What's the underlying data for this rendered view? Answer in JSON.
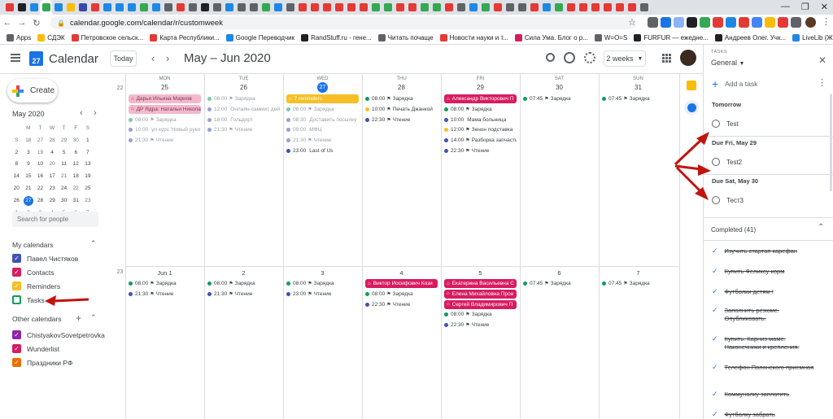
{
  "browser": {
    "url": "calendar.google.com/calendar/r/customweek",
    "bookmarks": [
      "Apps",
      "СДЭК",
      "Петровское сельск...",
      "Карта Республики...",
      "Google Переводчик",
      "RandStuff.ru - гене...",
      "Читать почаще",
      "Новости науки и т...",
      "Сила Ума. Блог о р...",
      "W=O=S",
      "FURFUR — ежедне...",
      "Андреев Олег. Учк...",
      "LiveLib (Живая биб..."
    ],
    "accent": "#1a73e8"
  },
  "header": {
    "app_title": "Calendar",
    "logo_day": "27",
    "today_label": "Today",
    "date_range": "May – Jun 2020",
    "view": "2 weeks"
  },
  "sidebar": {
    "create_label": "Create",
    "mini_month": "May 2020",
    "weekday_heads": [
      "M",
      "T",
      "W",
      "T",
      "F",
      "S",
      "S"
    ],
    "mini_weeks": [
      {
        "wk": "18",
        "days": [
          "27",
          "28",
          "29",
          "30",
          "1",
          "2",
          "3"
        ]
      },
      {
        "wk": "19",
        "days": [
          "4",
          "5",
          "6",
          "7",
          "8",
          "9",
          "10"
        ]
      },
      {
        "wk": "20",
        "days": [
          "11",
          "12",
          "13",
          "14",
          "15",
          "16",
          "17"
        ]
      },
      {
        "wk": "21",
        "days": [
          "18",
          "19",
          "20",
          "21",
          "22",
          "23",
          "24"
        ]
      },
      {
        "wk": "22",
        "days": [
          "25",
          "26",
          "27",
          "28",
          "29",
          "30",
          "31"
        ]
      },
      {
        "wk": "23",
        "days": [
          "1",
          "2",
          "3",
          "4",
          "5",
          "6",
          "7"
        ]
      }
    ],
    "search_placeholder": "Search for people",
    "my_calendars_label": "My calendars",
    "my_calendars": [
      {
        "name": "Павел Чистяков",
        "color": "#3f51b5"
      },
      {
        "name": "Contacts",
        "color": "#d81b60"
      },
      {
        "name": "Reminders",
        "color": "#f6bf26"
      },
      {
        "name": "Tasks",
        "color": "#0f9d58"
      }
    ],
    "other_calendars_label": "Other calendars",
    "other_calendars": [
      {
        "name": "ChistyakovSovetpetrovka",
        "color": "#8e24aa"
      },
      {
        "name": "Wunderlist",
        "color": "#d81b60"
      },
      {
        "name": "Праздники РФ",
        "color": "#ef6c00"
      }
    ]
  },
  "week1": {
    "number": "22",
    "days": [
      {
        "name": "MON",
        "num": "25"
      },
      {
        "name": "TUE",
        "num": "26"
      },
      {
        "name": "WED",
        "num": "27"
      },
      {
        "name": "THU",
        "num": "28"
      },
      {
        "name": "FRI",
        "num": "29"
      },
      {
        "name": "SAT",
        "num": "30"
      },
      {
        "name": "SUN",
        "num": "31"
      }
    ]
  },
  "week2": {
    "number": "23",
    "days": [
      "Jun 1",
      "2",
      "3",
      "4",
      "5",
      "6",
      "7"
    ]
  },
  "events_w1": [
    [
      {
        "kind": "allday",
        "style": "pastpink",
        "text": "Дарья Ильина Мариов"
      },
      {
        "kind": "allday",
        "style": "pastpink",
        "text": "ДР Ядра: Натальи Никола"
      },
      {
        "kind": "timed",
        "past": true,
        "color": "#0f9d58",
        "time": "08:00",
        "flag": true,
        "text": "Зарядка"
      },
      {
        "kind": "timed",
        "past": true,
        "color": "#3f51b5",
        "time": "10:00",
        "flag": false,
        "text": "ул курс 'Новый руко"
      },
      {
        "kind": "timed",
        "past": true,
        "color": "#3f51b5",
        "time": "21:30",
        "flag": true,
        "text": "Чтение"
      }
    ],
    [
      {
        "kind": "timed",
        "past": true,
        "color": "#0f9d58",
        "time": "08:00",
        "flag": true,
        "text": "Зарядка"
      },
      {
        "kind": "timed",
        "past": true,
        "color": "#3f51b5",
        "time": "12:00",
        "flag": false,
        "text": "Онлайн-саммит дей"
      },
      {
        "kind": "timed",
        "past": true,
        "color": "#3f51b5",
        "time": "18:00",
        "flag": false,
        "text": "Гольдорт"
      },
      {
        "kind": "timed",
        "past": true,
        "color": "#3f51b5",
        "time": "21:30",
        "flag": true,
        "text": "Чтение"
      }
    ],
    [
      {
        "kind": "allday",
        "style": "yellow",
        "text": "7 reminders"
      },
      {
        "kind": "timed",
        "past": true,
        "color": "#0f9d58",
        "time": "08:00",
        "flag": true,
        "text": "Зарядка"
      },
      {
        "kind": "timed",
        "past": true,
        "color": "#3f51b5",
        "time": "08:30",
        "flag": false,
        "text": "Доставить посылку"
      },
      {
        "kind": "timed",
        "past": true,
        "color": "#3f51b5",
        "time": "09:00",
        "flag": false,
        "text": "МФЦ"
      },
      {
        "kind": "timed",
        "past": true,
        "color": "#3f51b5",
        "time": "21:30",
        "flag": true,
        "text": "Чтение"
      },
      {
        "kind": "timed",
        "past": false,
        "color": "#3f51b5",
        "time": "23:00",
        "flag": false,
        "text": "Last of Us"
      }
    ],
    [
      {
        "kind": "timed",
        "past": false,
        "color": "#0f9d58",
        "time": "08:00",
        "flag": true,
        "text": "Зарядка"
      },
      {
        "kind": "timed",
        "past": false,
        "color": "#f6bf26",
        "time": "10:00",
        "flag": true,
        "text": "Печать Джанкой"
      },
      {
        "kind": "timed",
        "past": false,
        "color": "#3f51b5",
        "time": "22:30",
        "flag": true,
        "text": "Чтение"
      }
    ],
    [
      {
        "kind": "allday",
        "style": "pink",
        "text": "Александр Викторович П"
      },
      {
        "kind": "timed",
        "past": false,
        "color": "#0f9d58",
        "time": "08:00",
        "flag": true,
        "text": "Зарядка"
      },
      {
        "kind": "timed",
        "past": false,
        "color": "#3f51b5",
        "time": "10:00",
        "flag": false,
        "text": "Мама больница"
      },
      {
        "kind": "timed",
        "past": false,
        "color": "#f6bf26",
        "time": "12:00",
        "flag": true,
        "text": "Зенон подставка"
      },
      {
        "kind": "timed",
        "past": false,
        "color": "#3f51b5",
        "time": "14:00",
        "flag": true,
        "text": "Разборка запчасти"
      },
      {
        "kind": "timed",
        "past": false,
        "color": "#3f51b5",
        "time": "22:30",
        "flag": true,
        "text": "Чтение"
      }
    ],
    [
      {
        "kind": "timed",
        "past": false,
        "color": "#0f9d58",
        "time": "07:45",
        "flag": true,
        "text": "Зарядка"
      }
    ],
    [
      {
        "kind": "timed",
        "past": false,
        "color": "#0f9d58",
        "time": "07:45",
        "flag": true,
        "text": "Зарядка"
      }
    ]
  ],
  "events_w2": [
    [
      {
        "kind": "timed",
        "past": false,
        "color": "#0f9d58",
        "time": "08:00",
        "flag": true,
        "text": "Зарядка"
      },
      {
        "kind": "timed",
        "past": false,
        "color": "#3f51b5",
        "time": "21:30",
        "flag": true,
        "text": "Чтение"
      }
    ],
    [
      {
        "kind": "timed",
        "past": false,
        "color": "#0f9d58",
        "time": "08:00",
        "flag": true,
        "text": "Зарядка"
      },
      {
        "kind": "timed",
        "past": false,
        "color": "#3f51b5",
        "time": "21:30",
        "flag": true,
        "text": "Чтение"
      }
    ],
    [
      {
        "kind": "timed",
        "past": false,
        "color": "#0f9d58",
        "time": "08:00",
        "flag": true,
        "text": "Зарядка"
      },
      {
        "kind": "timed",
        "past": false,
        "color": "#3f51b5",
        "time": "23:00",
        "flag": true,
        "text": "Чтение"
      }
    ],
    [
      {
        "kind": "allday",
        "style": "pink",
        "text": "Виктор Иосифович Кози"
      },
      {
        "kind": "timed",
        "past": false,
        "color": "#0f9d58",
        "time": "08:00",
        "flag": true,
        "text": "Зарядка"
      },
      {
        "kind": "timed",
        "past": false,
        "color": "#3f51b5",
        "time": "22:30",
        "flag": true,
        "text": "Чтение"
      }
    ],
    [
      {
        "kind": "allday",
        "style": "pink",
        "text": "Екатерина Васильевна С"
      },
      {
        "kind": "allday",
        "style": "pink",
        "text": "Елена Михайловна Прое"
      },
      {
        "kind": "allday",
        "style": "pink",
        "text": "Сергей Владимирович П"
      },
      {
        "kind": "timed",
        "past": false,
        "color": "#0f9d58",
        "time": "08:00",
        "flag": true,
        "text": "Зарядка"
      },
      {
        "kind": "timed",
        "past": false,
        "color": "#3f51b5",
        "time": "22:30",
        "flag": true,
        "text": "Чтение"
      }
    ],
    [
      {
        "kind": "timed",
        "past": false,
        "color": "#0f9d58",
        "time": "07:45",
        "flag": true,
        "text": "Зарядка"
      }
    ],
    [
      {
        "kind": "timed",
        "past": false,
        "color": "#0f9d58",
        "time": "07:45",
        "flag": true,
        "text": "Зарядка"
      }
    ]
  ],
  "tasks_panel": {
    "header_label": "TASKS",
    "list_name": "General",
    "add_label": "Add a task",
    "groups": [
      {
        "label": "Tomorrow",
        "task": "Test"
      },
      {
        "label": "Due Fri, May 29",
        "task": "Test2"
      },
      {
        "label": "Due Sat, May 30",
        "task": "Тест3"
      }
    ],
    "completed_label": "Completed (41)",
    "completed": [
      "Изучить стартап карефан",
      "Купить Феликсу корм",
      "Футболки детям !",
      "Заполнить резюме. Опубликовать.",
      "Купить. Карниз маме. Наконечники и крепления.",
      "Телефон Полонского приемная",
      "Коммуналку заплатить",
      "Футболку забрать"
    ]
  }
}
